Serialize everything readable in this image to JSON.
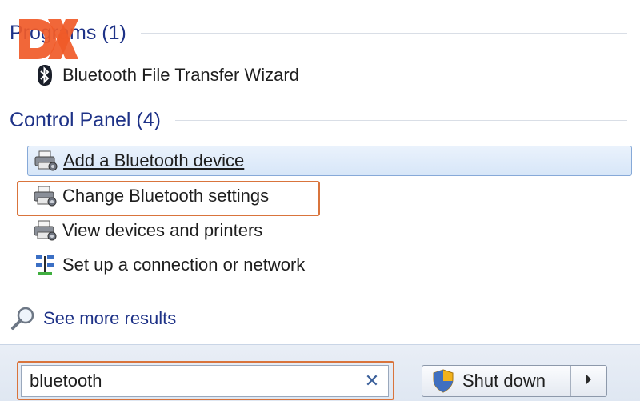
{
  "programs": {
    "header": "Programs (1)",
    "items": [
      {
        "label": "Bluetooth File Transfer Wizard",
        "icon": "bluetooth-icon"
      }
    ]
  },
  "control_panel": {
    "header": "Control Panel (4)",
    "items": [
      {
        "label": "Add a Bluetooth device",
        "icon": "devices-printer-icon",
        "state": "hover"
      },
      {
        "label": "Change Bluetooth settings",
        "icon": "devices-printer-icon",
        "state": "highlighted"
      },
      {
        "label": "View devices and printers",
        "icon": "devices-printer-icon"
      },
      {
        "label": "Set up a connection or network",
        "icon": "network-icon"
      }
    ]
  },
  "see_more": {
    "label": "See more results",
    "icon": "search-icon"
  },
  "search": {
    "value": "bluetooth",
    "clear_icon": "close-icon"
  },
  "shutdown": {
    "label": "Shut down",
    "icon": "shield-icon",
    "arrow_icon": "arrow-right-icon"
  },
  "watermark": {
    "icon": "dx-logo-icon",
    "text": "DX"
  },
  "colors": {
    "header_text": "#1e3287",
    "highlight_border": "#d9743c",
    "hover_fill": "#d7e6f8",
    "watermark": "#f05a28"
  }
}
